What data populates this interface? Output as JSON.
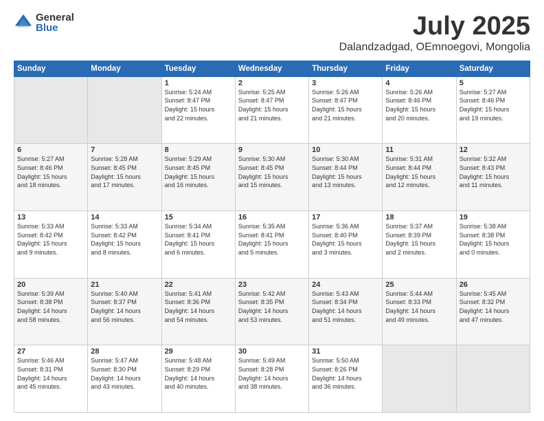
{
  "logo": {
    "general": "General",
    "blue": "Blue"
  },
  "header": {
    "title": "July 2025",
    "subtitle": "Dalandzadgad, OEmnoegovi, Mongolia"
  },
  "weekdays": [
    "Sunday",
    "Monday",
    "Tuesday",
    "Wednesday",
    "Thursday",
    "Friday",
    "Saturday"
  ],
  "weeks": [
    [
      {
        "day": "",
        "info": ""
      },
      {
        "day": "",
        "info": ""
      },
      {
        "day": "1",
        "info": "Sunrise: 5:24 AM\nSunset: 8:47 PM\nDaylight: 15 hours\nand 22 minutes."
      },
      {
        "day": "2",
        "info": "Sunrise: 5:25 AM\nSunset: 8:47 PM\nDaylight: 15 hours\nand 21 minutes."
      },
      {
        "day": "3",
        "info": "Sunrise: 5:26 AM\nSunset: 8:47 PM\nDaylight: 15 hours\nand 21 minutes."
      },
      {
        "day": "4",
        "info": "Sunrise: 5:26 AM\nSunset: 8:46 PM\nDaylight: 15 hours\nand 20 minutes."
      },
      {
        "day": "5",
        "info": "Sunrise: 5:27 AM\nSunset: 8:46 PM\nDaylight: 15 hours\nand 19 minutes."
      }
    ],
    [
      {
        "day": "6",
        "info": "Sunrise: 5:27 AM\nSunset: 8:46 PM\nDaylight: 15 hours\nand 18 minutes."
      },
      {
        "day": "7",
        "info": "Sunrise: 5:28 AM\nSunset: 8:45 PM\nDaylight: 15 hours\nand 17 minutes."
      },
      {
        "day": "8",
        "info": "Sunrise: 5:29 AM\nSunset: 8:45 PM\nDaylight: 15 hours\nand 16 minutes."
      },
      {
        "day": "9",
        "info": "Sunrise: 5:30 AM\nSunset: 8:45 PM\nDaylight: 15 hours\nand 15 minutes."
      },
      {
        "day": "10",
        "info": "Sunrise: 5:30 AM\nSunset: 8:44 PM\nDaylight: 15 hours\nand 13 minutes."
      },
      {
        "day": "11",
        "info": "Sunrise: 5:31 AM\nSunset: 8:44 PM\nDaylight: 15 hours\nand 12 minutes."
      },
      {
        "day": "12",
        "info": "Sunrise: 5:32 AM\nSunset: 8:43 PM\nDaylight: 15 hours\nand 11 minutes."
      }
    ],
    [
      {
        "day": "13",
        "info": "Sunrise: 5:33 AM\nSunset: 8:42 PM\nDaylight: 15 hours\nand 9 minutes."
      },
      {
        "day": "14",
        "info": "Sunrise: 5:33 AM\nSunset: 8:42 PM\nDaylight: 15 hours\nand 8 minutes."
      },
      {
        "day": "15",
        "info": "Sunrise: 5:34 AM\nSunset: 8:41 PM\nDaylight: 15 hours\nand 6 minutes."
      },
      {
        "day": "16",
        "info": "Sunrise: 5:35 AM\nSunset: 8:41 PM\nDaylight: 15 hours\nand 5 minutes."
      },
      {
        "day": "17",
        "info": "Sunrise: 5:36 AM\nSunset: 8:40 PM\nDaylight: 15 hours\nand 3 minutes."
      },
      {
        "day": "18",
        "info": "Sunrise: 5:37 AM\nSunset: 8:39 PM\nDaylight: 15 hours\nand 2 minutes."
      },
      {
        "day": "19",
        "info": "Sunrise: 5:38 AM\nSunset: 8:38 PM\nDaylight: 15 hours\nand 0 minutes."
      }
    ],
    [
      {
        "day": "20",
        "info": "Sunrise: 5:39 AM\nSunset: 8:38 PM\nDaylight: 14 hours\nand 58 minutes."
      },
      {
        "day": "21",
        "info": "Sunrise: 5:40 AM\nSunset: 8:37 PM\nDaylight: 14 hours\nand 56 minutes."
      },
      {
        "day": "22",
        "info": "Sunrise: 5:41 AM\nSunset: 8:36 PM\nDaylight: 14 hours\nand 54 minutes."
      },
      {
        "day": "23",
        "info": "Sunrise: 5:42 AM\nSunset: 8:35 PM\nDaylight: 14 hours\nand 53 minutes."
      },
      {
        "day": "24",
        "info": "Sunrise: 5:43 AM\nSunset: 8:34 PM\nDaylight: 14 hours\nand 51 minutes."
      },
      {
        "day": "25",
        "info": "Sunrise: 5:44 AM\nSunset: 8:33 PM\nDaylight: 14 hours\nand 49 minutes."
      },
      {
        "day": "26",
        "info": "Sunrise: 5:45 AM\nSunset: 8:32 PM\nDaylight: 14 hours\nand 47 minutes."
      }
    ],
    [
      {
        "day": "27",
        "info": "Sunrise: 5:46 AM\nSunset: 8:31 PM\nDaylight: 14 hours\nand 45 minutes."
      },
      {
        "day": "28",
        "info": "Sunrise: 5:47 AM\nSunset: 8:30 PM\nDaylight: 14 hours\nand 43 minutes."
      },
      {
        "day": "29",
        "info": "Sunrise: 5:48 AM\nSunset: 8:29 PM\nDaylight: 14 hours\nand 40 minutes."
      },
      {
        "day": "30",
        "info": "Sunrise: 5:49 AM\nSunset: 8:28 PM\nDaylight: 14 hours\nand 38 minutes."
      },
      {
        "day": "31",
        "info": "Sunrise: 5:50 AM\nSunset: 8:26 PM\nDaylight: 14 hours\nand 36 minutes."
      },
      {
        "day": "",
        "info": ""
      },
      {
        "day": "",
        "info": ""
      }
    ]
  ]
}
